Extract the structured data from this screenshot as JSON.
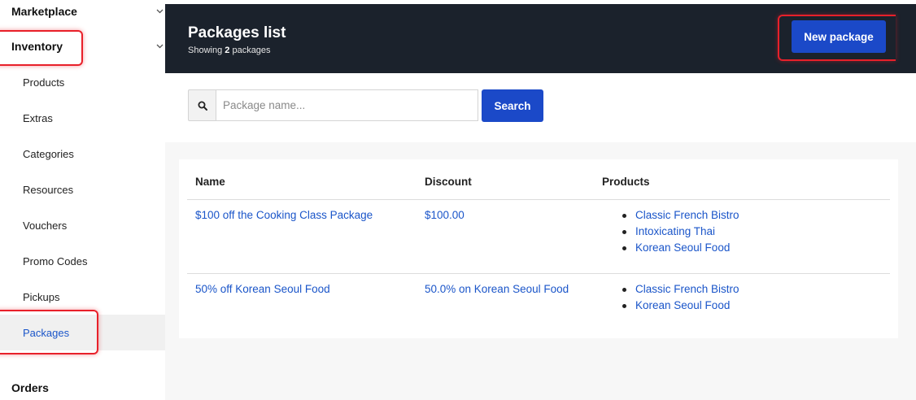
{
  "sidebar": {
    "sections": [
      {
        "label": "Marketplace"
      },
      {
        "label": "Inventory"
      },
      {
        "label": "Orders"
      }
    ],
    "items": [
      {
        "label": "Products"
      },
      {
        "label": "Extras"
      },
      {
        "label": "Categories"
      },
      {
        "label": "Resources"
      },
      {
        "label": "Vouchers"
      },
      {
        "label": "Promo Codes"
      },
      {
        "label": "Pickups"
      },
      {
        "label": "Packages",
        "active": true
      }
    ]
  },
  "header": {
    "title": "Packages list",
    "subtitle_prefix": "Showing",
    "count": "2",
    "subtitle_suffix": "packages",
    "new_button_label": "New package"
  },
  "search": {
    "placeholder": "Package name...",
    "value": "",
    "button_label": "Search",
    "icon": "search-icon"
  },
  "table": {
    "headers": [
      "Name",
      "Discount",
      "Products"
    ],
    "rows": [
      {
        "name": "$100 off the Cooking Class Package",
        "discount": "$100.00",
        "products": [
          "Classic French Bistro",
          "Intoxicating Thai",
          "Korean Seoul Food"
        ]
      },
      {
        "name": "50% off Korean Seoul Food",
        "discount": "50.0% on Korean Seoul Food",
        "products": [
          "Classic French Bistro",
          "Korean Seoul Food"
        ]
      }
    ]
  },
  "colors": {
    "header_bg": "#1b222c",
    "primary": "#1b49c8",
    "link": "#1a55c9",
    "highlight": "#e8202a"
  }
}
